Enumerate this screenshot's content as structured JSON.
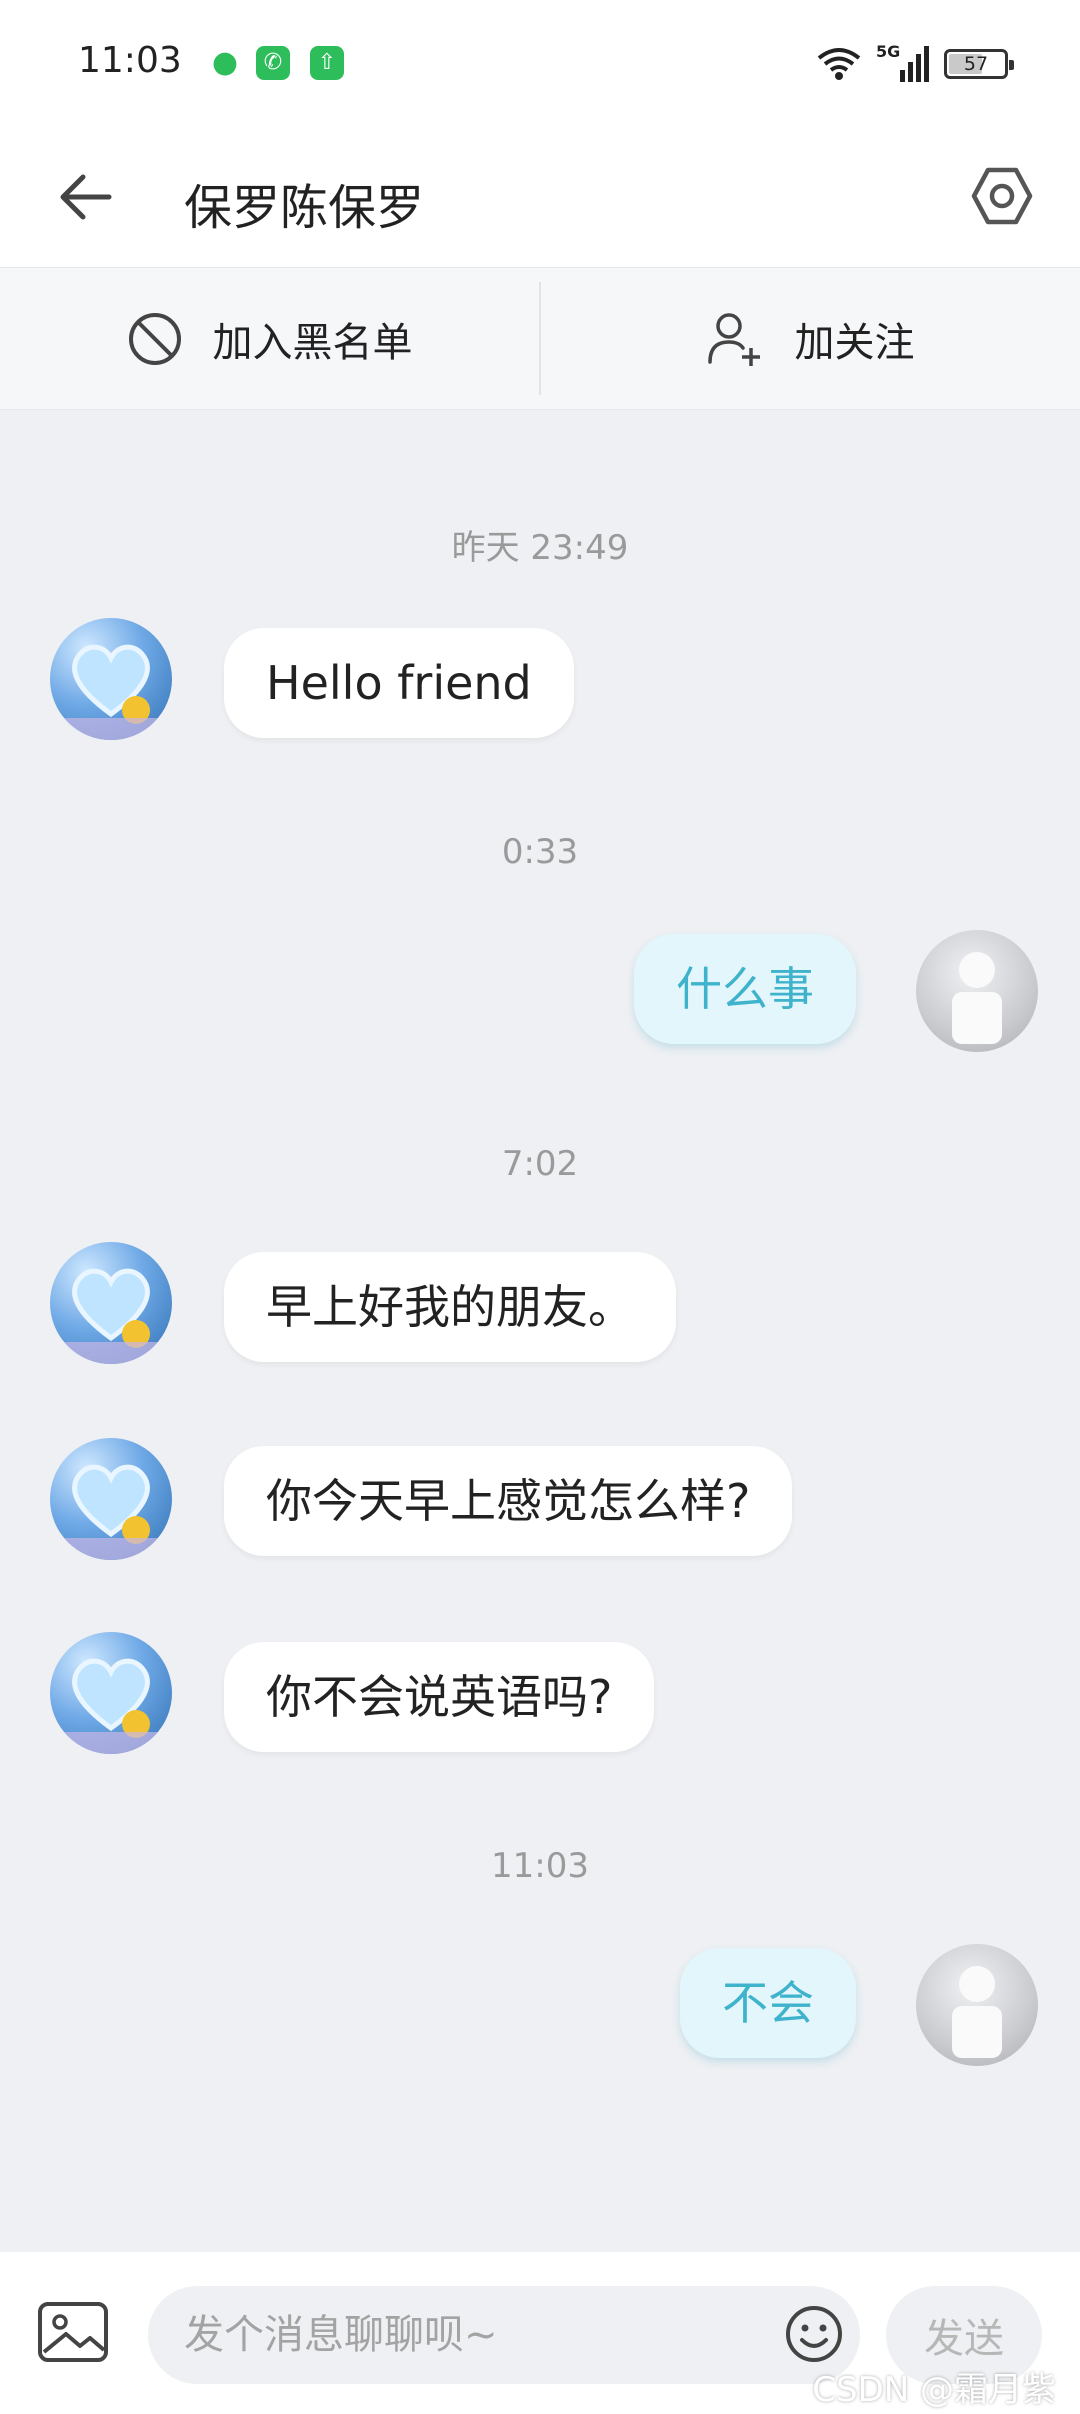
{
  "status_bar": {
    "time": "11:03",
    "network": "5G",
    "battery": "57",
    "battery_level": 0.57
  },
  "header": {
    "title": "保罗陈保罗"
  },
  "actions": {
    "blacklist_label": "加入黑名单",
    "follow_label": "加关注"
  },
  "messages": [
    {
      "type": "timestamp",
      "text": "昨天 23:49"
    },
    {
      "type": "incoming",
      "text": "Hello friend"
    },
    {
      "type": "timestamp",
      "text": "0:33"
    },
    {
      "type": "outgoing",
      "text": "什么事"
    },
    {
      "type": "timestamp",
      "text": "7:02"
    },
    {
      "type": "incoming",
      "text": "早上好我的朋友。"
    },
    {
      "type": "incoming",
      "text": "你今天早上感觉怎么样?"
    },
    {
      "type": "incoming",
      "text": "你不会说英语吗?"
    },
    {
      "type": "timestamp",
      "text": "11:03"
    },
    {
      "type": "outgoing",
      "text": "不会"
    }
  ],
  "input": {
    "placeholder": "发个消息聊聊呗~",
    "send_label": "发送"
  },
  "watermark": "CSDN @霜月紫",
  "colors": {
    "outgoing_text": "#3fb3cc",
    "outgoing_bubble": "#e3f6fb",
    "background": "#eef0f3"
  }
}
